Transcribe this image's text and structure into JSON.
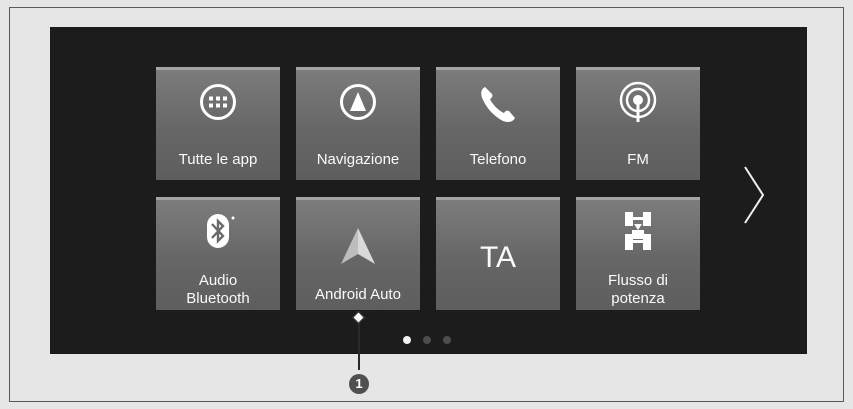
{
  "tiles": [
    {
      "id": "all-apps",
      "label": "Tutte le app",
      "icon": "apps-grid-icon"
    },
    {
      "id": "navigation",
      "label": "Navigazione",
      "icon": "navigation-icon"
    },
    {
      "id": "phone",
      "label": "Telefono",
      "icon": "phone-icon"
    },
    {
      "id": "fm",
      "label": "FM",
      "icon": "radio-antenna-icon"
    },
    {
      "id": "audio-bluetooth",
      "label_line1": "Audio",
      "label_line2": "Bluetooth",
      "icon": "bluetooth-icon"
    },
    {
      "id": "android-auto",
      "label": "Android Auto",
      "icon": "android-auto-icon"
    },
    {
      "id": "ta",
      "label": "TA"
    },
    {
      "id": "power-flow",
      "label_line1": "Flusso di",
      "label_line2": "potenza",
      "icon": "power-flow-icon"
    }
  ],
  "pagination": {
    "pages": 3,
    "current": 1
  },
  "next_page_icon": "chevron-right-icon",
  "callout": {
    "number": "1"
  },
  "colors": {
    "screen": "#1c1c1c",
    "tile": "#6e6e6e",
    "background": "#e6e6e6"
  }
}
